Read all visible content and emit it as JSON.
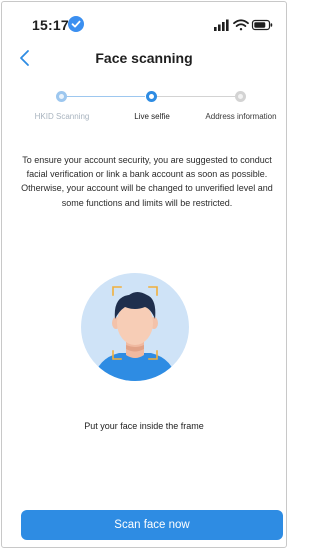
{
  "status_bar": {
    "time": "15:17"
  },
  "nav": {
    "title": "Face scanning"
  },
  "stepper": {
    "steps": [
      {
        "label": "HKID Scanning",
        "state": "done"
      },
      {
        "label": "Live selfie",
        "state": "active"
      },
      {
        "label": "Address information",
        "state": "pending"
      }
    ]
  },
  "message": "To ensure your account security, you are suggested to conduct facial verification or link a bank account as soon as possible. Otherwise, your account will be changed to unverified level and some functions and limits will be restricted.",
  "hint": "Put your face inside the frame",
  "actions": {
    "scan_label": "Scan face now"
  },
  "colors": {
    "accent": "#2e8ce3",
    "step_done": "#9dc7ef",
    "step_pending": "#d3d3d3",
    "face_circle": "#cfe3f7",
    "frame_corners": "#f0b03c"
  }
}
